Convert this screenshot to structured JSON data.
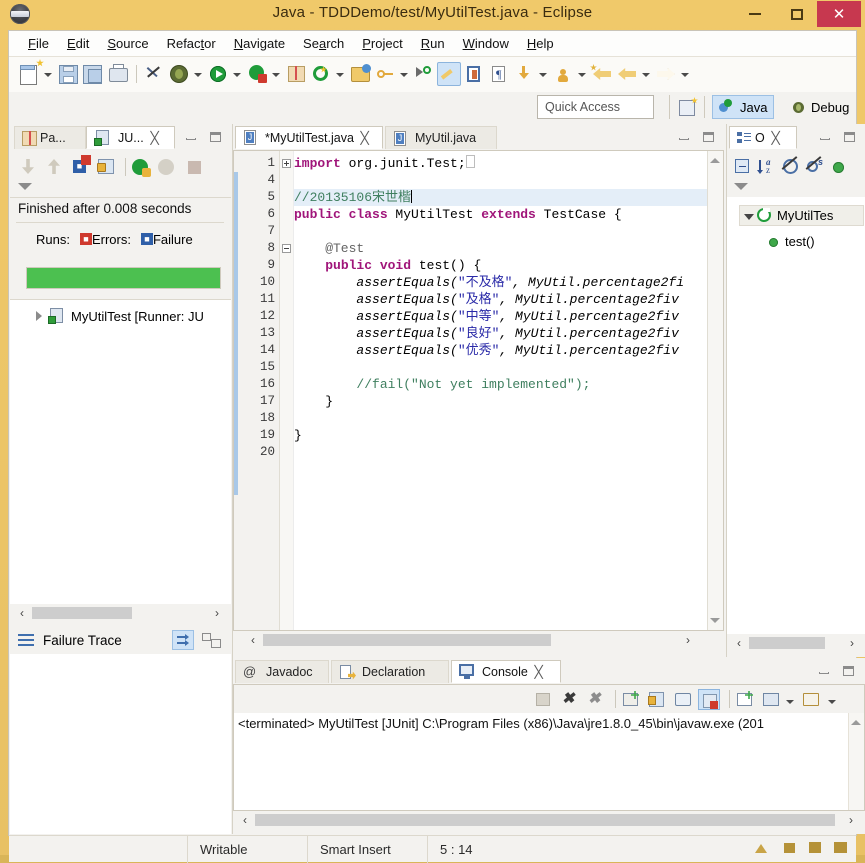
{
  "window": {
    "title": "Java - TDDDemo/test/MyUtilTest.java - Eclipse",
    "app_icon": "eclipse-icon",
    "minimize_label": "Minimize",
    "maximize_label": "Maximize",
    "close_label": "Close",
    "titlebar_color": "#f0c96a",
    "close_button_color": "#c7384f"
  },
  "menubar": {
    "items": [
      {
        "label": "File",
        "mnemonic": "F"
      },
      {
        "label": "Edit",
        "mnemonic": "E"
      },
      {
        "label": "Source",
        "mnemonic": "S"
      },
      {
        "label": "Refactor",
        "mnemonic": "t"
      },
      {
        "label": "Navigate",
        "mnemonic": "N"
      },
      {
        "label": "Search",
        "mnemonic": "a"
      },
      {
        "label": "Project",
        "mnemonic": "P"
      },
      {
        "label": "Run",
        "mnemonic": "R"
      },
      {
        "label": "Window",
        "mnemonic": "W"
      },
      {
        "label": "Help",
        "mnemonic": "H"
      }
    ]
  },
  "toolbar": {
    "buttons": [
      {
        "name": "new-wizard",
        "icon": "new-file-icon",
        "has_dropdown": true
      },
      {
        "name": "save",
        "icon": "save-icon",
        "has_dropdown": false
      },
      {
        "name": "save-all",
        "icon": "save-all-icon",
        "has_dropdown": false
      },
      {
        "name": "print",
        "icon": "print-icon",
        "has_dropdown": false
      },
      {
        "name": "toggle-mark-occurrences",
        "icon": "pen-strike-icon",
        "has_dropdown": false
      },
      {
        "name": "debug",
        "icon": "bug-icon",
        "has_dropdown": true
      },
      {
        "name": "run",
        "icon": "run-green-play-icon",
        "has_dropdown": true
      },
      {
        "name": "run-coverage",
        "icon": "coverage-icon",
        "has_dropdown": true
      },
      {
        "name": "new-java-package",
        "icon": "package-icon",
        "has_dropdown": false
      },
      {
        "name": "new-java-class",
        "icon": "new-class-icon",
        "has_dropdown": true
      },
      {
        "name": "open-type",
        "icon": "open-folder-icon",
        "has_dropdown": false
      },
      {
        "name": "search",
        "icon": "key-search-icon",
        "has_dropdown": true
      },
      {
        "name": "next-annotation",
        "icon": "marker-icon",
        "has_dropdown": false
      },
      {
        "name": "toggle-mark",
        "icon": "brush-icon",
        "has_dropdown": false,
        "active": true
      },
      {
        "name": "toggle-block-selection",
        "icon": "book-icon",
        "has_dropdown": false
      },
      {
        "name": "show-whitespace",
        "icon": "pilcrow-icon",
        "has_dropdown": false
      },
      {
        "name": "skip-breakpoints",
        "icon": "down-arrow-icon",
        "has_dropdown": true
      },
      {
        "name": "open-task",
        "icon": "person-icon",
        "has_dropdown": true
      },
      {
        "name": "back-history",
        "icon": "back-arrow-star-icon",
        "has_dropdown": false
      },
      {
        "name": "back",
        "icon": "back-arrow-icon",
        "has_dropdown": true
      },
      {
        "name": "forward",
        "icon": "forward-arrow-icon",
        "has_dropdown": true
      }
    ],
    "quick_access_placeholder": "Quick Access",
    "open_perspective_icon": "open-perspective-icon",
    "perspectives": [
      {
        "label": "Java",
        "icon": "java-perspective-icon",
        "active": true
      },
      {
        "label": "Debug",
        "icon": "debug-perspective-icon",
        "active": false
      }
    ]
  },
  "junit_view": {
    "tabs": [
      {
        "label": "Pa...",
        "icon": "package-explorer-icon",
        "active": false,
        "closable": false
      },
      {
        "label": "JU...",
        "icon": "junit-icon",
        "active": true,
        "closable": true
      }
    ],
    "toolbar_icons": [
      "next-failure-icon",
      "previous-failure-icon",
      "show-failures-only-icon",
      "lock-scroll-icon",
      "rerun-test-icon",
      "rerun-failed-icon",
      "stop-icon",
      "view-menu-icon"
    ],
    "status_text": "Finished after 0.008 seconds",
    "counts": {
      "runs_label": "Runs:",
      "errors_label": "Errors:",
      "failures_label": "Failure"
    },
    "progress_bar_color": "#4cc050",
    "progress_percent": 100,
    "tree": [
      {
        "label": "MyUtilTest [Runner: JU",
        "icon": "test-suite-icon",
        "expandable": true
      }
    ],
    "failure_trace_label": "Failure Trace",
    "failure_trace_icon": "stack-trace-icon",
    "failure_trace_buttons": [
      "filter-stack-trace-icon",
      "compare-result-icon"
    ]
  },
  "editor": {
    "tabs": [
      {
        "label": "*MyUtilTest.java",
        "icon": "java-file-icon",
        "active": true,
        "closable": true,
        "dirty": true
      },
      {
        "label": "MyUtil.java",
        "icon": "java-file-icon",
        "active": false,
        "closable": false,
        "dirty": false
      }
    ],
    "lines": [
      {
        "no": "1",
        "fold": "plus",
        "segments": [
          {
            "t": "import",
            "c": "kw"
          },
          {
            "t": " org.junit.Test;",
            "c": ""
          },
          {
            "t": "BOX",
            "c": "box"
          }
        ]
      },
      {
        "no": "4",
        "fold": "",
        "segments": []
      },
      {
        "no": "5",
        "fold": "",
        "highlight": true,
        "segments": [
          {
            "t": "//20135106宋世楷",
            "c": "cmt"
          },
          {
            "t": "CARET",
            "c": "caret"
          }
        ]
      },
      {
        "no": "6",
        "fold": "",
        "segments": [
          {
            "t": "public ",
            "c": "kw"
          },
          {
            "t": "class ",
            "c": "kw"
          },
          {
            "t": "MyUtilTest ",
            "c": ""
          },
          {
            "t": "extends ",
            "c": "kw"
          },
          {
            "t": "TestCase {",
            "c": ""
          }
        ]
      },
      {
        "no": "7",
        "fold": "",
        "segments": []
      },
      {
        "no": "8",
        "fold": "minus",
        "segments": [
          {
            "t": "    @Test",
            "c": "ann"
          }
        ]
      },
      {
        "no": "9",
        "fold": "",
        "segments": [
          {
            "t": "    ",
            "c": ""
          },
          {
            "t": "public ",
            "c": "kw"
          },
          {
            "t": "void ",
            "c": "kw"
          },
          {
            "t": "test() {",
            "c": ""
          }
        ]
      },
      {
        "no": "10",
        "fold": "",
        "segments": [
          {
            "t": "        ",
            "c": ""
          },
          {
            "t": "assertEquals(",
            "c": "it"
          },
          {
            "t": "\"不及格\"",
            "c": "str"
          },
          {
            "t": ", MyUtil.",
            "c": "it"
          },
          {
            "t": "percentage2fi",
            "c": "it"
          }
        ]
      },
      {
        "no": "11",
        "fold": "",
        "segments": [
          {
            "t": "        ",
            "c": ""
          },
          {
            "t": "assertEquals(",
            "c": "it"
          },
          {
            "t": "\"及格\"",
            "c": "str"
          },
          {
            "t": ", MyUtil.",
            "c": "it"
          },
          {
            "t": "percentage2fiv",
            "c": "it"
          }
        ]
      },
      {
        "no": "12",
        "fold": "",
        "segments": [
          {
            "t": "        ",
            "c": ""
          },
          {
            "t": "assertEquals(",
            "c": "it"
          },
          {
            "t": "\"中等\"",
            "c": "str"
          },
          {
            "t": ", MyUtil.",
            "c": "it"
          },
          {
            "t": "percentage2fiv",
            "c": "it"
          }
        ]
      },
      {
        "no": "13",
        "fold": "",
        "segments": [
          {
            "t": "        ",
            "c": ""
          },
          {
            "t": "assertEquals(",
            "c": "it"
          },
          {
            "t": "\"良好\"",
            "c": "str"
          },
          {
            "t": ", MyUtil.",
            "c": "it"
          },
          {
            "t": "percentage2fiv",
            "c": "it"
          }
        ]
      },
      {
        "no": "14",
        "fold": "",
        "segments": [
          {
            "t": "        ",
            "c": ""
          },
          {
            "t": "assertEquals(",
            "c": "it"
          },
          {
            "t": "\"优秀\"",
            "c": "str"
          },
          {
            "t": ", MyUtil.",
            "c": "it"
          },
          {
            "t": "percentage2fiv",
            "c": "it"
          }
        ]
      },
      {
        "no": "15",
        "fold": "",
        "segments": []
      },
      {
        "no": "16",
        "fold": "",
        "segments": [
          {
            "t": "        //fail(\"Not yet implemented\");",
            "c": "cmt"
          }
        ]
      },
      {
        "no": "17",
        "fold": "",
        "segments": [
          {
            "t": "    }",
            "c": ""
          }
        ]
      },
      {
        "no": "18",
        "fold": "",
        "segments": []
      },
      {
        "no": "19",
        "fold": "",
        "segments": [
          {
            "t": "}",
            "c": ""
          }
        ]
      },
      {
        "no": "20",
        "fold": "",
        "segments": []
      }
    ]
  },
  "outline_view": {
    "tabs": [
      {
        "label": "O",
        "icon": "outline-icon",
        "active": true,
        "closable": true
      }
    ],
    "toolbar_icons": [
      "collapse-all-icon",
      "sort-alphabetically-icon",
      "hide-fields-icon",
      "hide-static-icon",
      "hide-nonpublic-icon",
      "view-menu-icon"
    ],
    "tree": [
      {
        "label": "MyUtilTes",
        "icon": "class-icon",
        "depth": 0,
        "expanded": true,
        "selected": true
      },
      {
        "label": "test()",
        "icon": "method-public-icon",
        "depth": 1,
        "expanded": false,
        "selected": false
      }
    ]
  },
  "console_view": {
    "tabs": [
      {
        "label": "Javadoc",
        "icon": "javadoc-icon",
        "active": false,
        "closable": false
      },
      {
        "label": "Declaration",
        "icon": "declaration-icon",
        "active": false,
        "closable": false
      },
      {
        "label": "Console",
        "icon": "console-icon",
        "active": true,
        "closable": true
      }
    ],
    "toolbar_icons": [
      "clear-console-icon",
      "terminate-icon",
      "remove-launch-icon",
      "remove-all-terminated-icon",
      "scroll-lock-icon",
      "word-wrap-icon",
      "pin-console-icon",
      "display-selected-console-icon",
      "open-console-icon",
      "new-console-view-icon"
    ],
    "output": "<terminated> MyUtilTest [JUnit] C:\\Program Files (x86)\\Java\\jre1.8.0_45\\bin\\javaw.exe (201"
  },
  "statusbar": {
    "writable": "Writable",
    "insert_mode": "Smart Insert",
    "cursor_position": "5 : 14"
  }
}
